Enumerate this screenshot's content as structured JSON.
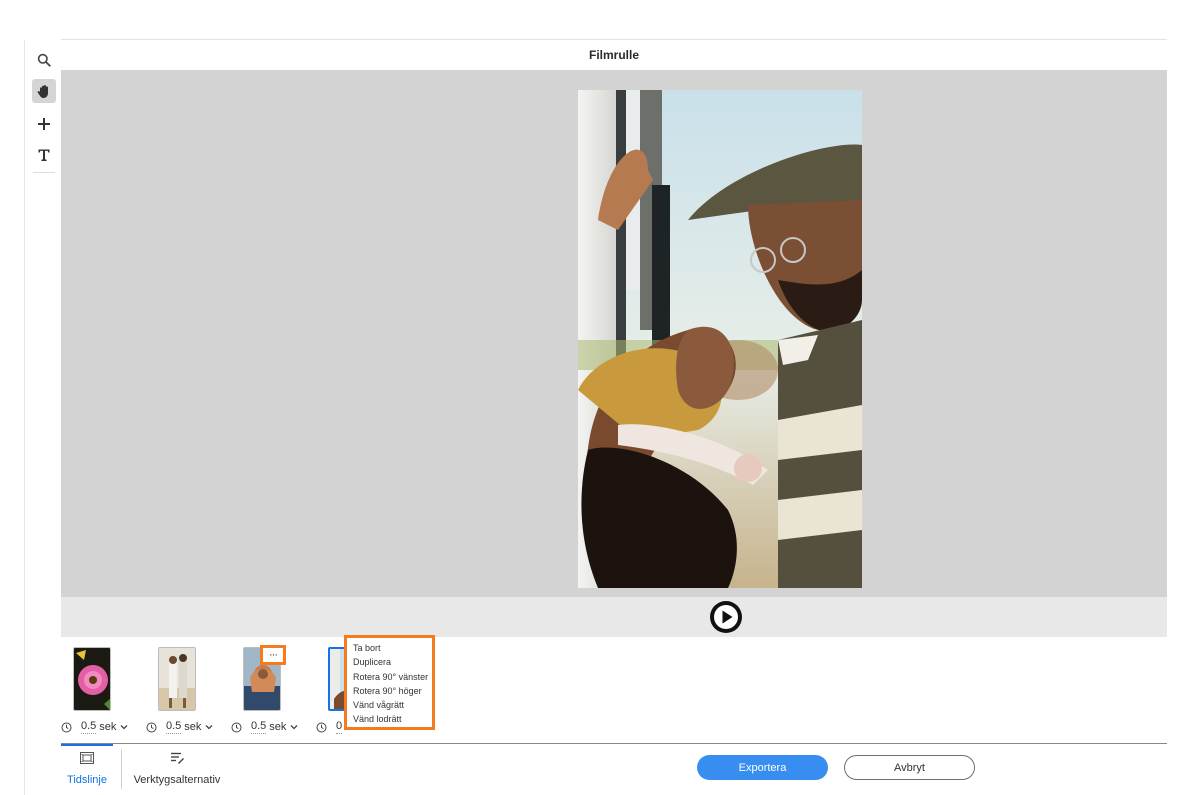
{
  "panel": {
    "title": "Filmrulle"
  },
  "tools": [
    {
      "name": "zoom-tool",
      "icon": "magnifier-icon",
      "active": false
    },
    {
      "name": "hand-tool",
      "icon": "hand-icon",
      "active": true
    },
    {
      "name": "add-tool",
      "icon": "plus-icon",
      "active": false
    },
    {
      "name": "text-tool",
      "icon": "text-icon",
      "active": false
    }
  ],
  "filmstrip": {
    "frames": [
      {
        "duration": "0.5",
        "unit": "sek"
      },
      {
        "duration": "0.5",
        "unit": "sek"
      },
      {
        "duration": "0.5",
        "unit": "sek"
      },
      {
        "duration": "0",
        "unit": ""
      }
    ],
    "more_label": "···"
  },
  "context_menu": {
    "items": [
      "Ta bort",
      "Duplicera",
      "Rotera 90° vänster",
      "Rotera 90° höger",
      "Vänd vågrätt",
      "Vänd lodrätt"
    ]
  },
  "tabs": [
    {
      "label": "Tidslinje",
      "icon": "filmstrip-icon",
      "active": true
    },
    {
      "label": "Verktygsalternativ",
      "icon": "tool-options-icon",
      "active": false
    }
  ],
  "actions": {
    "export_label": "Exportera",
    "cancel_label": "Avbryt"
  },
  "colors": {
    "accent": "#1473e6",
    "export_button": "#378ef0",
    "highlight": "#f47b20",
    "canvas": "#d3d3d3"
  }
}
